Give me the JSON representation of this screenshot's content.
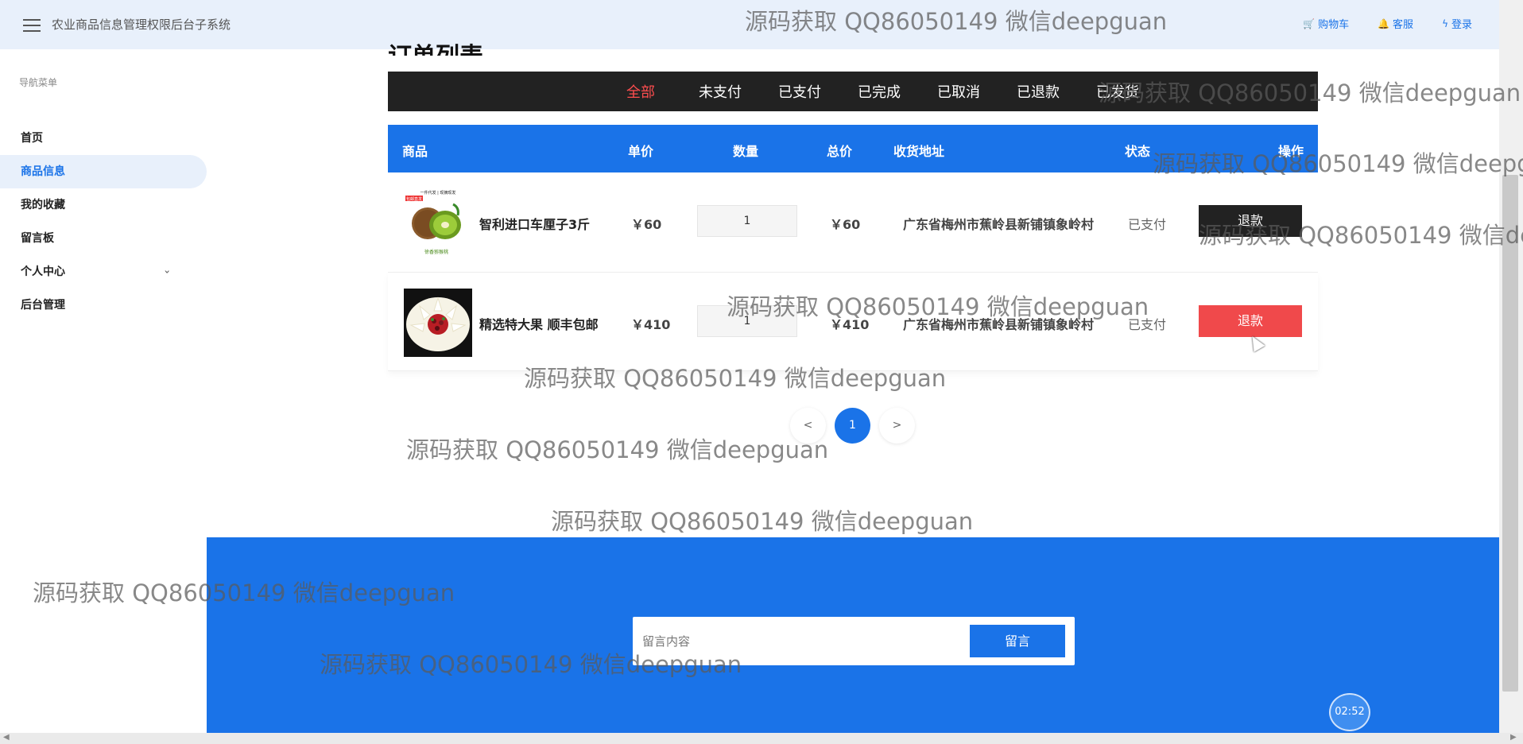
{
  "header": {
    "app_title": "农业商品信息管理权限后台子系统",
    "links": [
      {
        "label": "购物车",
        "icon": "cart-icon"
      },
      {
        "label": "客服",
        "icon": "bell-icon"
      },
      {
        "label": "登录",
        "icon": "bolt-icon"
      }
    ]
  },
  "sidebar": {
    "heading": "导航菜单",
    "items": [
      {
        "label": "首页"
      },
      {
        "label": "商品信息"
      },
      {
        "label": "我的收藏"
      },
      {
        "label": "留言板"
      },
      {
        "label": "个人中心"
      },
      {
        "label": "后台管理"
      }
    ]
  },
  "page": {
    "title": "订单列表",
    "filter_tabs": [
      "全部",
      "未支付",
      "已支付",
      "已完成",
      "已取消",
      "已退款",
      "已发货"
    ],
    "columns": [
      "商品",
      "单价",
      "数量",
      "总价",
      "收货地址",
      "状态",
      "操作"
    ]
  },
  "orders": [
    {
      "name": "智利进口车厘子3斤",
      "price": "￥60",
      "qty": "1",
      "total": "￥60",
      "address": "广东省梅州市蕉岭县新铺镇象岭村",
      "status": "已支付",
      "action": "退款",
      "thumb_text_top": "一件代发 | 现摘现发",
      "thumb_text_mid": "包邮直发",
      "thumb_text_bottom": "徐香猕猴桃"
    },
    {
      "name": "精选特大果 顺丰包邮",
      "price": "￥410",
      "qty": "1",
      "total": "￥410",
      "address": "广东省梅州市蕉岭县新铺镇象岭村",
      "status": "已支付",
      "action": "退款"
    }
  ],
  "pagination": {
    "prev": "<",
    "current": "1",
    "next": ">"
  },
  "footer": {
    "message_placeholder": "留言内容",
    "message_button": "留言",
    "timer": "02:52"
  },
  "watermark": "源码获取 QQ86050149 微信deepguan",
  "colors": {
    "primary": "#1a73e8",
    "active_tab": "#ff4d4f",
    "refund_red": "#f0494b",
    "dark_bar": "#222222"
  }
}
